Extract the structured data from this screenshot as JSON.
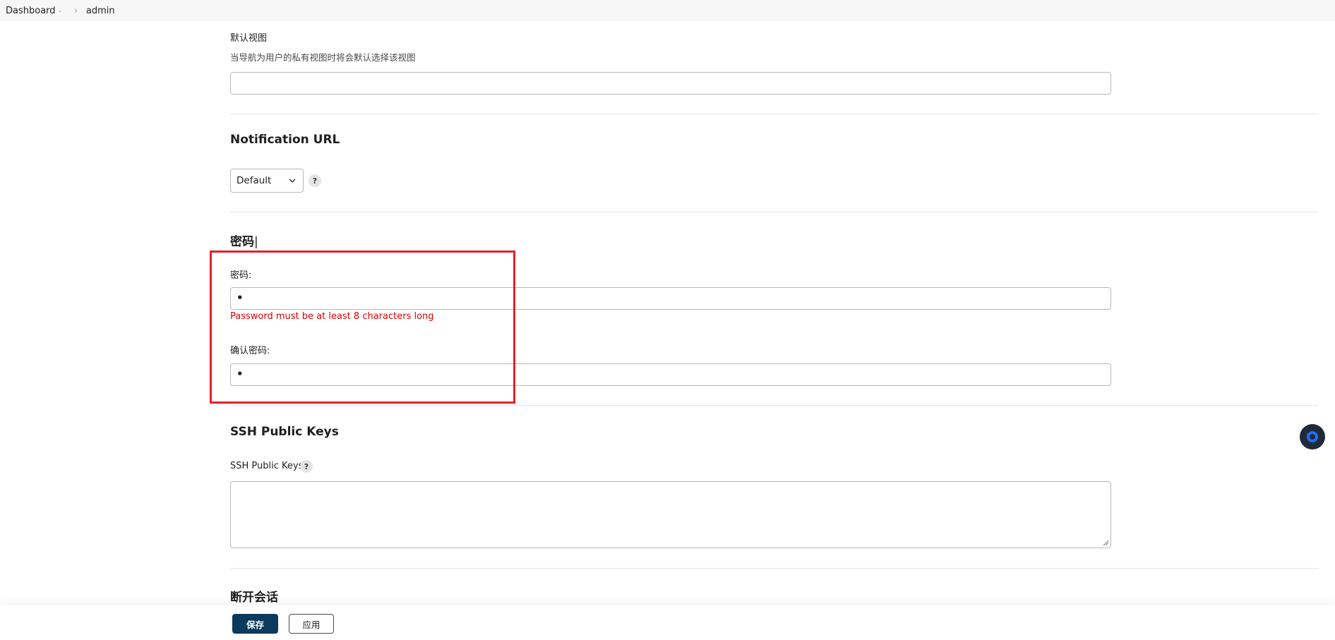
{
  "breadcrumb": {
    "items": [
      "Dashboard",
      "admin"
    ]
  },
  "default_view": {
    "label": "默认视图",
    "description": "当导航为用户的私有视图时将会默认选择该视图",
    "value": ""
  },
  "notification": {
    "title": "Notification URL",
    "select_value": "Default",
    "help": "?"
  },
  "password": {
    "section_title": "密码",
    "label": "密码:",
    "value": "•",
    "error": "Password must be at least 8 characters long",
    "confirm_label": "确认密码:",
    "confirm_value": "•"
  },
  "ssh": {
    "title": "SSH Public Keys",
    "label": "SSH Public Keys",
    "help": "?",
    "value": ""
  },
  "session": {
    "title": "断开会话"
  },
  "actions": {
    "save": "保存",
    "apply": "应用"
  },
  "colors": {
    "primary": "#0b3a5c",
    "error": "#e00000",
    "highlight": "#e4202a"
  }
}
